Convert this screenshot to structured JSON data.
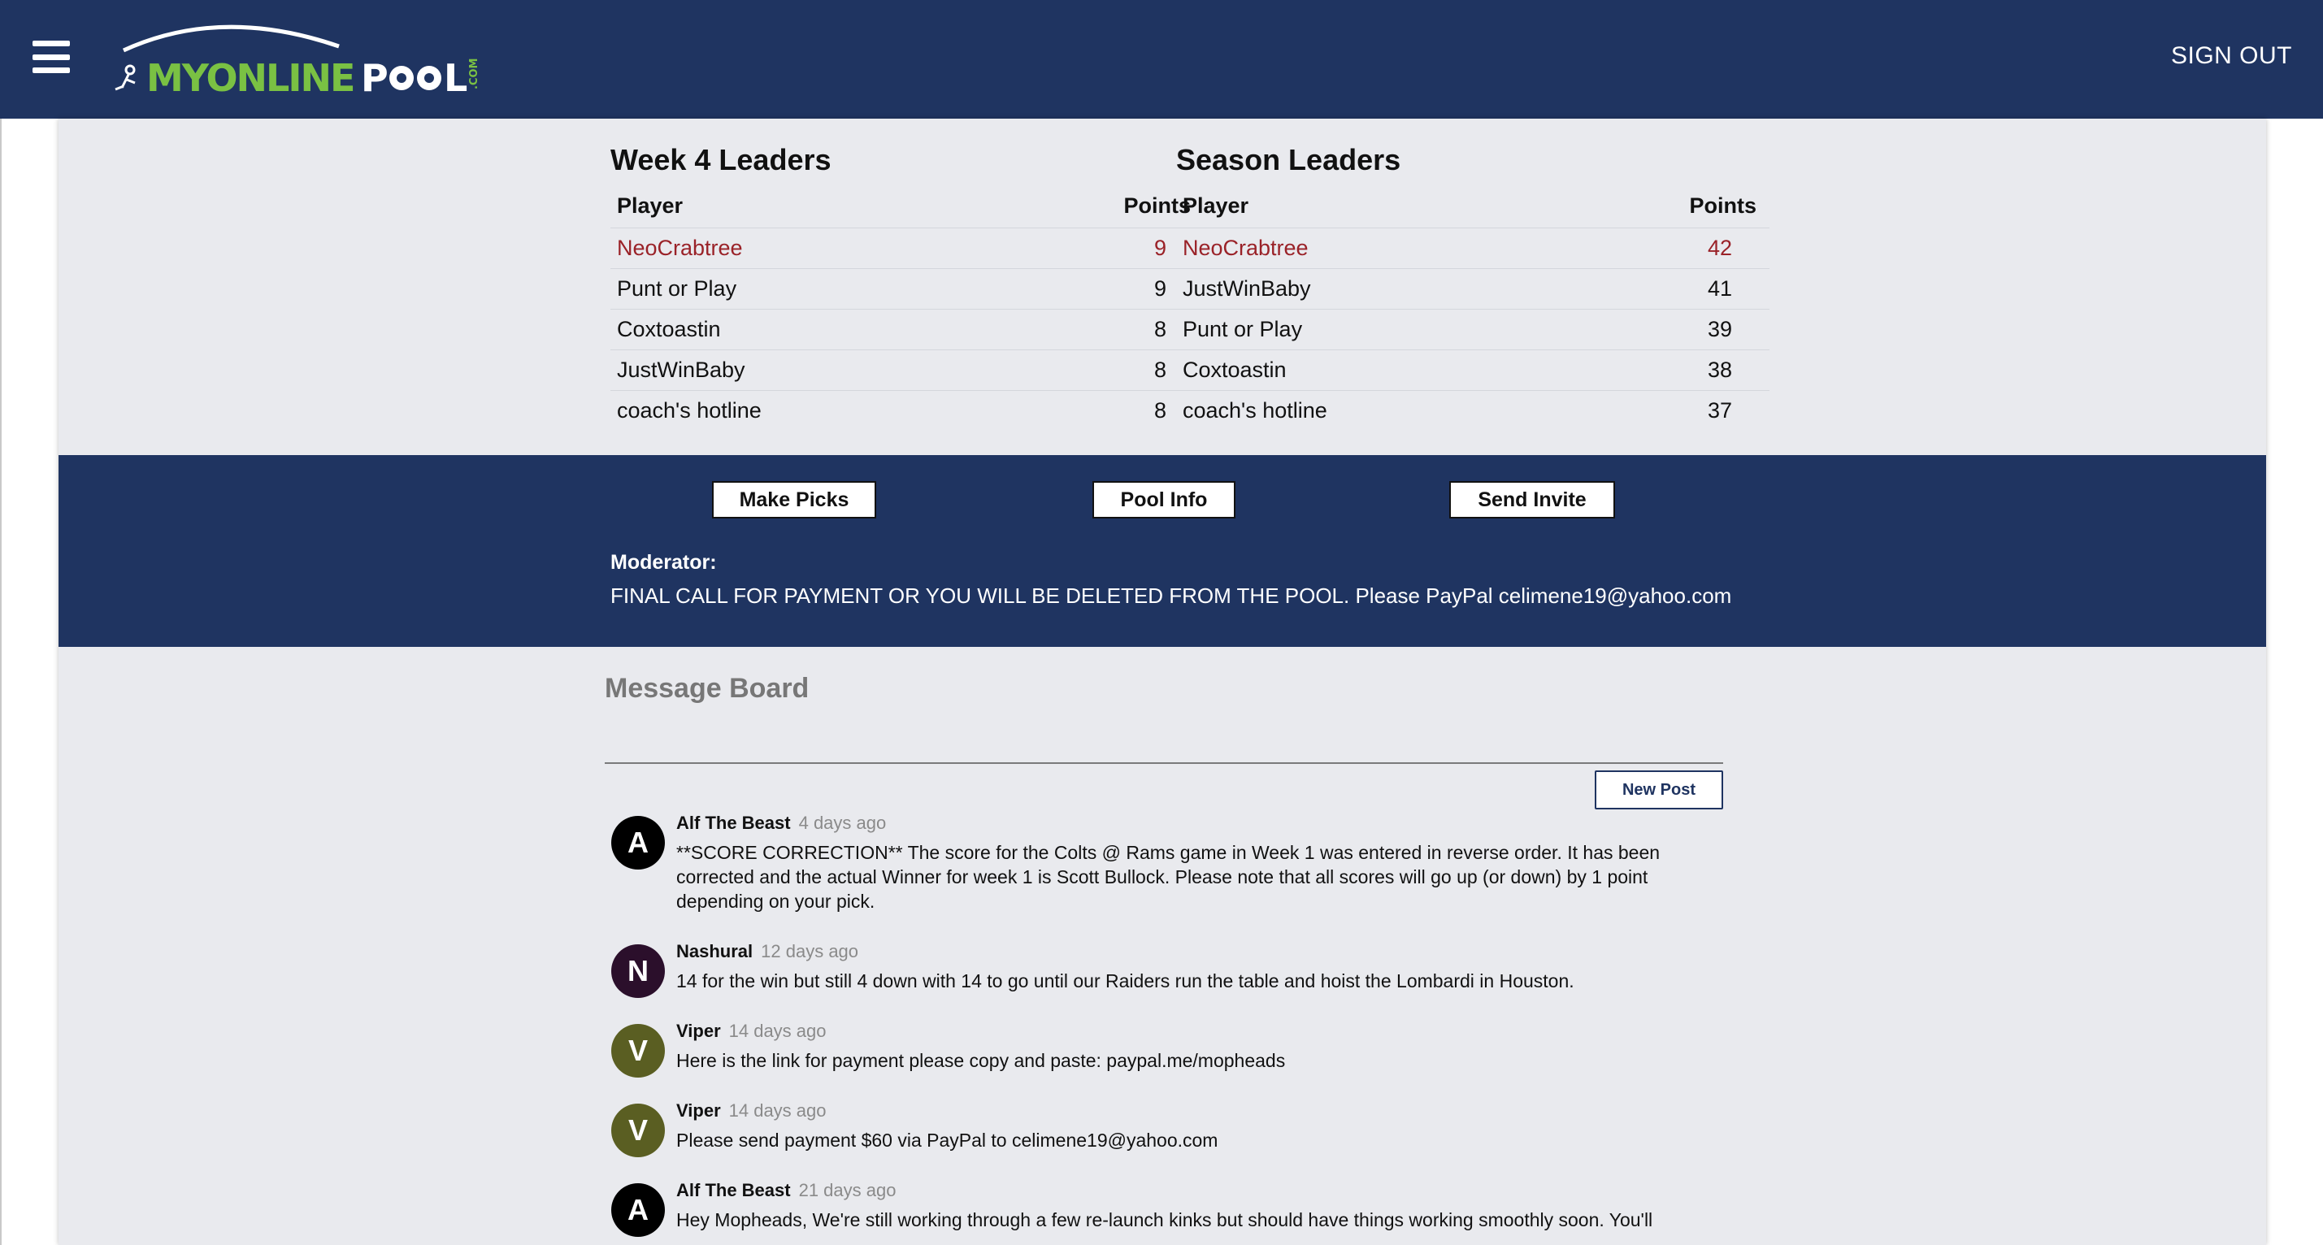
{
  "header": {
    "logo_text": "MYONLINEPOOL.COM",
    "sign_out": "SIGN OUT",
    "bg_color": "#1f3461"
  },
  "week_leaders": {
    "title": "Week 4 Leaders",
    "col_player": "Player",
    "col_points": "Points",
    "rows": [
      {
        "player": "NeoCrabtree",
        "points": "9"
      },
      {
        "player": "Punt or Play",
        "points": "9"
      },
      {
        "player": "Coxtoastin",
        "points": "8"
      },
      {
        "player": "JustWinBaby",
        "points": "8"
      },
      {
        "player": "coach's hotline",
        "points": "8"
      }
    ]
  },
  "season_leaders": {
    "title": "Season Leaders",
    "col_player": "Player",
    "col_points": "Points",
    "rows": [
      {
        "player": "NeoCrabtree",
        "points": "42"
      },
      {
        "player": "JustWinBaby",
        "points": "41"
      },
      {
        "player": "Punt or Play",
        "points": "39"
      },
      {
        "player": "Coxtoastin",
        "points": "38"
      },
      {
        "player": "coach's hotline",
        "points": "37"
      }
    ]
  },
  "actions": {
    "make_picks": "Make Picks",
    "pool_info": "Pool Info",
    "send_invite": "Send Invite"
  },
  "moderator": {
    "label": "Moderator:",
    "message": "FINAL CALL FOR PAYMENT OR YOU WILL BE DELETED FROM THE POOL. Please PayPal celimene19@yahoo.com"
  },
  "message_board": {
    "title": "Message Board",
    "new_post": "New Post",
    "posts": [
      {
        "initial": "A",
        "author": "Alf The Beast",
        "age": "4 days ago",
        "color": "#000000",
        "text": "**SCORE CORRECTION** The score for the Colts @ Rams game in Week 1 was entered in reverse order. It has been corrected and the actual Winner for week 1 is Scott Bullock. Please note that all scores will go up (or down) by 1 point depending on your pick."
      },
      {
        "initial": "N",
        "author": "Nashural",
        "age": "12 days ago",
        "color": "#2b0f2b",
        "text": "14 for the win but still 4 down with 14 to go until our Raiders run the table and hoist the Lombardi in Houston."
      },
      {
        "initial": "V",
        "author": "Viper",
        "age": "14 days ago",
        "color": "#5a5e22",
        "text": "Here is the link for payment please copy and paste: paypal.me/mopheads"
      },
      {
        "initial": "V",
        "author": "Viper",
        "age": "14 days ago",
        "color": "#5a5e22",
        "text": "Please send payment $60 via PayPal to celimene19@yahoo.com"
      },
      {
        "initial": "A",
        "author": "Alf The Beast",
        "age": "21 days ago",
        "color": "#000000",
        "text": "Hey Mopheads, We're still working through a few re-launch kinks but should have things working smoothly soon. You'll"
      }
    ]
  },
  "colors": {
    "leader_highlight": "#9a2228",
    "content_bg": "#e9eaee"
  }
}
